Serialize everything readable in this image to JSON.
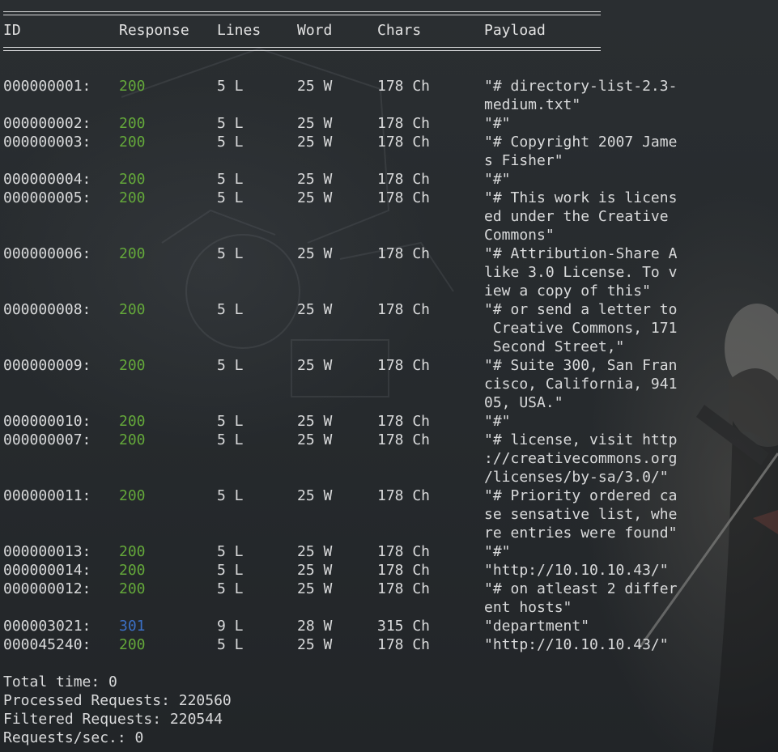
{
  "separator": "==================================================================",
  "header": {
    "id": "ID",
    "response": "Response",
    "lines": "Lines",
    "word": "Word",
    "chars": "Chars",
    "payload": "Payload"
  },
  "rows": [
    {
      "id": "000000001:",
      "response": "200",
      "lines": "5 L",
      "word": "25 W",
      "chars": "178 Ch",
      "payload": [
        "\"# directory-list-2.3-",
        "medium.txt\""
      ]
    },
    {
      "id": "000000002:",
      "response": "200",
      "lines": "5 L",
      "word": "25 W",
      "chars": "178 Ch",
      "payload": [
        "\"#\""
      ]
    },
    {
      "id": "000000003:",
      "response": "200",
      "lines": "5 L",
      "word": "25 W",
      "chars": "178 Ch",
      "payload": [
        "\"# Copyright 2007 Jame",
        "s Fisher\""
      ]
    },
    {
      "id": "000000004:",
      "response": "200",
      "lines": "5 L",
      "word": "25 W",
      "chars": "178 Ch",
      "payload": [
        "\"#\""
      ]
    },
    {
      "id": "000000005:",
      "response": "200",
      "lines": "5 L",
      "word": "25 W",
      "chars": "178 Ch",
      "payload": [
        "\"# This work is licens",
        "ed under the Creative",
        "Commons\""
      ]
    },
    {
      "id": "000000006:",
      "response": "200",
      "lines": "5 L",
      "word": "25 W",
      "chars": "178 Ch",
      "payload": [
        "\"# Attribution-Share A",
        "like 3.0 License. To v",
        "iew a copy of this\""
      ]
    },
    {
      "id": "000000008:",
      "response": "200",
      "lines": "5 L",
      "word": "25 W",
      "chars": "178 Ch",
      "payload": [
        "\"# or send a letter to",
        " Creative Commons, 171",
        " Second Street,\""
      ]
    },
    {
      "id": "000000009:",
      "response": "200",
      "lines": "5 L",
      "word": "25 W",
      "chars": "178 Ch",
      "payload": [
        "\"# Suite 300, San Fran",
        "cisco, California, 941",
        "05, USA.\""
      ]
    },
    {
      "id": "000000010:",
      "response": "200",
      "lines": "5 L",
      "word": "25 W",
      "chars": "178 Ch",
      "payload": [
        "\"#\""
      ]
    },
    {
      "id": "000000007:",
      "response": "200",
      "lines": "5 L",
      "word": "25 W",
      "chars": "178 Ch",
      "payload": [
        "\"# license, visit http",
        "://creativecommons.org",
        "/licenses/by-sa/3.0/\""
      ]
    },
    {
      "id": "000000011:",
      "response": "200",
      "lines": "5 L",
      "word": "25 W",
      "chars": "178 Ch",
      "payload": [
        "\"# Priority ordered ca",
        "se sensative list, whe",
        "re entries were found\""
      ]
    },
    {
      "id": "000000013:",
      "response": "200",
      "lines": "5 L",
      "word": "25 W",
      "chars": "178 Ch",
      "payload": [
        "\"#\""
      ]
    },
    {
      "id": "000000014:",
      "response": "200",
      "lines": "5 L",
      "word": "25 W",
      "chars": "178 Ch",
      "payload": [
        "\"http://10.10.10.43/\""
      ]
    },
    {
      "id": "000000012:",
      "response": "200",
      "lines": "5 L",
      "word": "25 W",
      "chars": "178 Ch",
      "payload": [
        "\"# on atleast 2 differ",
        "ent hosts\""
      ]
    },
    {
      "id": "000003021:",
      "response": "301",
      "lines": "9 L",
      "word": "28 W",
      "chars": "315 Ch",
      "payload": [
        "\"department\""
      ]
    },
    {
      "id": "000045240:",
      "response": "200",
      "lines": "5 L",
      "word": "25 W",
      "chars": "178 Ch",
      "payload": [
        "\"http://10.10.10.43/\""
      ]
    }
  ],
  "summary": {
    "total_time": "Total time: 0",
    "processed": "Processed Requests: 220560",
    "filtered": "Filtered Requests: 220544",
    "rate": "Requests/sec.: 0"
  },
  "colors": {
    "status_200": "#64a83a",
    "status_301": "#3b6fc4",
    "text": "#d9dadb",
    "background": "#262a2c"
  }
}
